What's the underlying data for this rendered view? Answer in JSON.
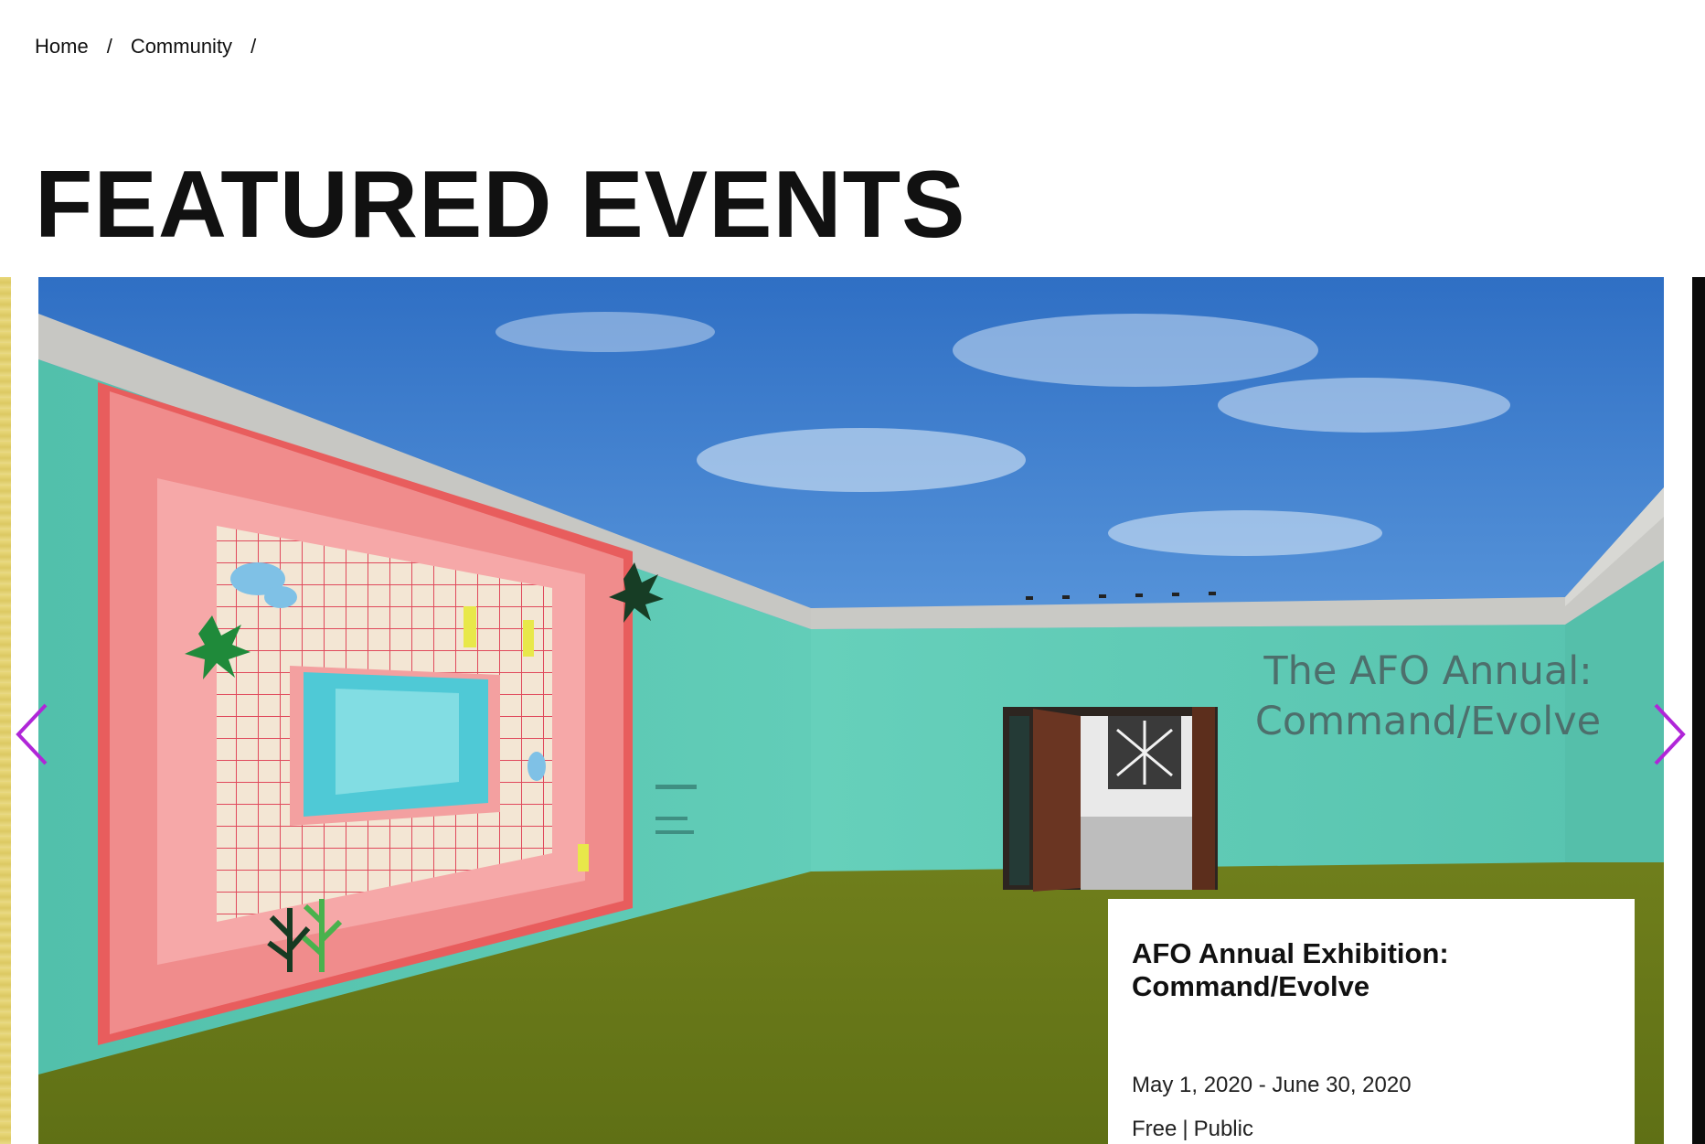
{
  "breadcrumb": {
    "home": "Home",
    "community": "Community",
    "separator": "/"
  },
  "section": {
    "title": "FEATURED EVENTS"
  },
  "carousel": {
    "prev_icon": "chevron-left-icon",
    "next_icon": "chevron-right-icon",
    "arrow_color": "#b026d8",
    "slide": {
      "wall_sign_line1": "The AFO Annual:",
      "wall_sign_line2": "Command/Evolve",
      "event": {
        "title": "AFO Annual Exhibition: Command/Evolve",
        "date": "May 1, 2020 - June 30, 2020",
        "price": "Free",
        "divider": "|",
        "audience": "Public"
      }
    }
  },
  "colors": {
    "wall": "#5ecbb6",
    "floor": "#6b7a1a",
    "sky": "#3a7fd0",
    "title_text": "#111111"
  }
}
